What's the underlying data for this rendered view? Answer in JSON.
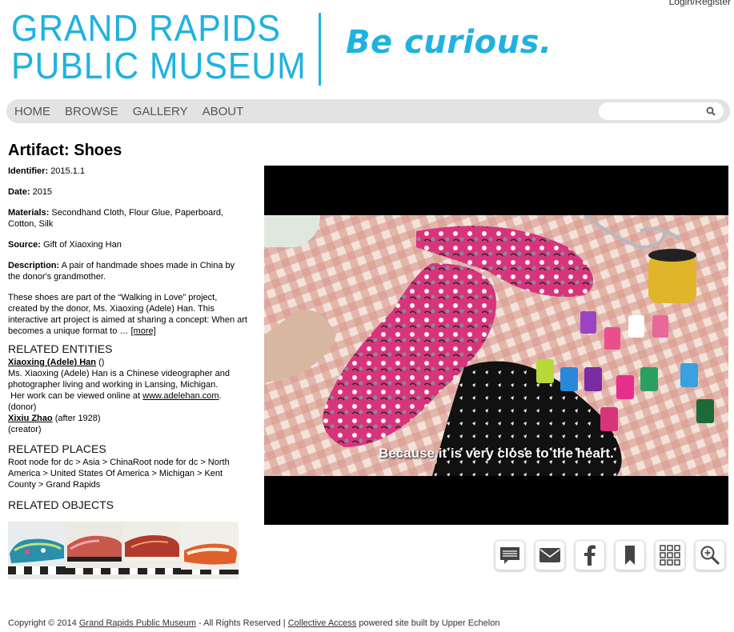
{
  "header": {
    "login_label": "Login/Register",
    "logo_line1": "GRAND RAPIDS",
    "logo_line2": "PUBLIC MUSEUM",
    "tagline": "Be curious.",
    "brand_color": "#1fb2e0"
  },
  "nav": {
    "items": [
      "HOME",
      "BROWSE",
      "GALLERY",
      "ABOUT"
    ],
    "search_placeholder": "",
    "search_icon": "search-icon"
  },
  "artifact": {
    "title": "Artifact: Shoes",
    "identifier_label": "Identifier:",
    "identifier": "2015.1.1",
    "date_label": "Date:",
    "date": "2015",
    "materials_label": "Materials:",
    "materials": "Secondhand Cloth, Flour Glue, Paperboard, Cotton, Silk",
    "source_label": "Source:",
    "source": "Gift of Xiaoxing Han",
    "description_label": "Description:",
    "description": "A pair of handmade shoes made in China by the donor's grandmother.",
    "description_more": "These shoes are part of the “Walking in Love” project, created by the donor, Ms. Xiaoxing (Adele) Han.  This interactive art project is aimed at sharing a concept: When art becomes a unique format to …",
    "more_link": "[more]"
  },
  "related_entities": {
    "heading": "RELATED ENTITIES",
    "entity1_name": "Xiaoxing (Adele) Han",
    "entity1_suffix": "()",
    "entity1_bio": "Ms. Xiaoxing (Adele) Han is a Chinese videographer and photographer living and working in Lansing, Michigan.",
    "entity1_bio2": "Her work can be viewed online at",
    "entity1_url": "www.adelehan.com",
    "entity1_role": "(donor)",
    "entity2_name": "Xixiu Zhao",
    "entity2_suffix": "(after 1928)",
    "entity2_role": "(creator)"
  },
  "related_places": {
    "heading": "RELATED PLACES",
    "path": "Root node for dc > Asia > ChinaRoot node for dc > North America > United States Of America > Michigan > Kent County > Grand Rapids"
  },
  "related_objects": {
    "heading": "RELATED OBJECTS"
  },
  "video": {
    "subtitle": "Because it is very close to the heart."
  },
  "share": {
    "icons": [
      "comment-icon",
      "mail-icon",
      "facebook-icon",
      "bookmark-icon",
      "grid-icon",
      "zoom-icon"
    ]
  },
  "footer": {
    "prefix": "Copyright © 2014",
    "museum_link": "Grand Rapids Public Museum",
    "middle": "- All Rights Reserved |",
    "ca_link": "Collective Access",
    "suffix": "powered site built by Upper Echelon"
  }
}
